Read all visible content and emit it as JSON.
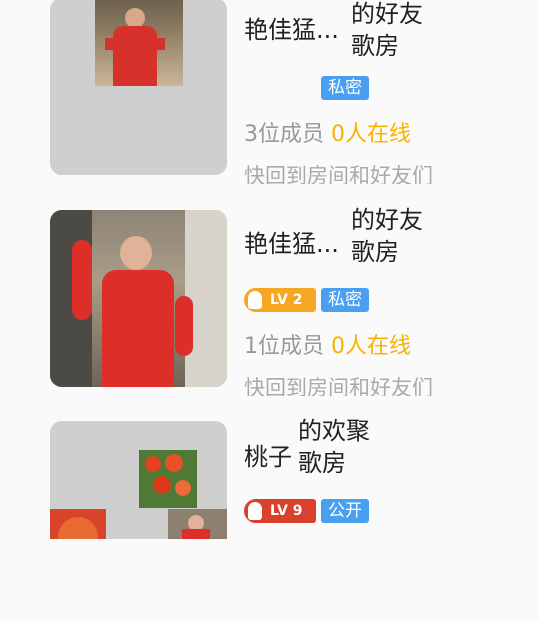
{
  "rooms": [
    {
      "title_left": "艳佳猛...",
      "title_right_line1": "的好友",
      "title_right_line2": "歌房",
      "privacy": "私密",
      "members": "3位成员",
      "online": "0人在线",
      "desc": "快回到房间和好友们"
    },
    {
      "title_left": "艳佳猛...",
      "title_right_line1": "的好友",
      "title_right_line2": "歌房",
      "level": "LV 2",
      "privacy": "私密",
      "members": "1位成员",
      "online": "0人在线",
      "desc": "快回到房间和好友们"
    },
    {
      "title_left": "桃子",
      "title_right_line1": "的欢聚",
      "title_right_line2": "歌房",
      "level": "LV 9",
      "privacy": "公开"
    }
  ],
  "colors": {
    "accent_blue": "#4aa0f0",
    "online_yellow": "#f5b400",
    "level_orange": "#f5a623",
    "level_red": "#d9412c"
  }
}
